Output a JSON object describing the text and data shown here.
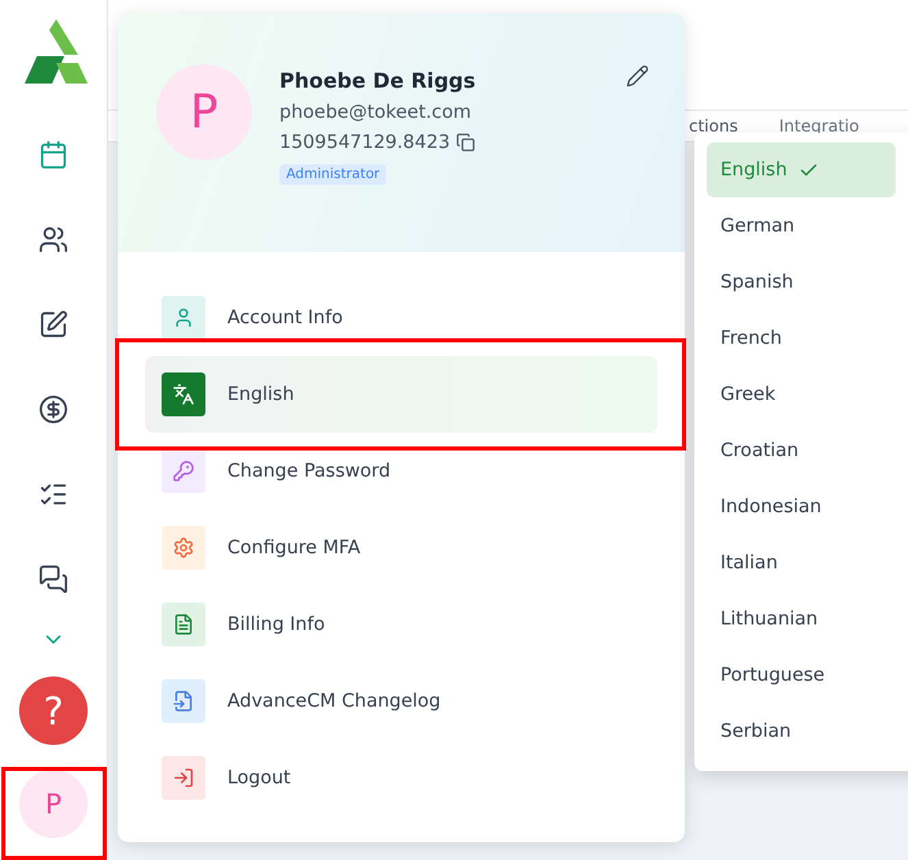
{
  "sidebar": {
    "nav_items": [
      {
        "kind": "calendar",
        "selected": true
      },
      {
        "kind": "users",
        "selected": false
      },
      {
        "kind": "edit",
        "selected": false
      },
      {
        "kind": "dollar",
        "selected": false
      },
      {
        "kind": "checklist",
        "selected": false
      },
      {
        "kind": "messages",
        "selected": false
      }
    ],
    "help_button": {
      "label": "?"
    },
    "user_avatar": {
      "initial": "P"
    }
  },
  "background_tabs": [
    {
      "label": "ctions"
    },
    {
      "label": "Integratio"
    }
  ],
  "profile": {
    "avatar_initial": "P",
    "name": "Phoebe De Riggs",
    "email": "phoebe@tokeet.com",
    "account_id": "1509547129.8423",
    "role": "Administrator"
  },
  "menu": [
    {
      "kind": "account",
      "label": "Account Info",
      "selected": false
    },
    {
      "kind": "language",
      "label": "English",
      "selected": true
    },
    {
      "kind": "password",
      "label": "Change Password",
      "selected": false
    },
    {
      "kind": "mfa",
      "label": "Configure MFA",
      "selected": false
    },
    {
      "kind": "billing",
      "label": "Billing Info",
      "selected": false
    },
    {
      "kind": "changelog",
      "label": "AdvanceCM Changelog",
      "selected": false
    },
    {
      "kind": "logout",
      "label": "Logout",
      "selected": false
    }
  ],
  "language_dropdown": {
    "options": [
      {
        "label": "English",
        "selected": true
      },
      {
        "label": "German",
        "selected": false
      },
      {
        "label": "Spanish",
        "selected": false
      },
      {
        "label": "French",
        "selected": false
      },
      {
        "label": "Greek",
        "selected": false
      },
      {
        "label": "Croatian",
        "selected": false
      },
      {
        "label": "Indonesian",
        "selected": false
      },
      {
        "label": "Italian",
        "selected": false
      },
      {
        "label": "Lithuanian",
        "selected": false
      },
      {
        "label": "Portuguese",
        "selected": false
      },
      {
        "label": "Serbian",
        "selected": false
      }
    ]
  }
}
